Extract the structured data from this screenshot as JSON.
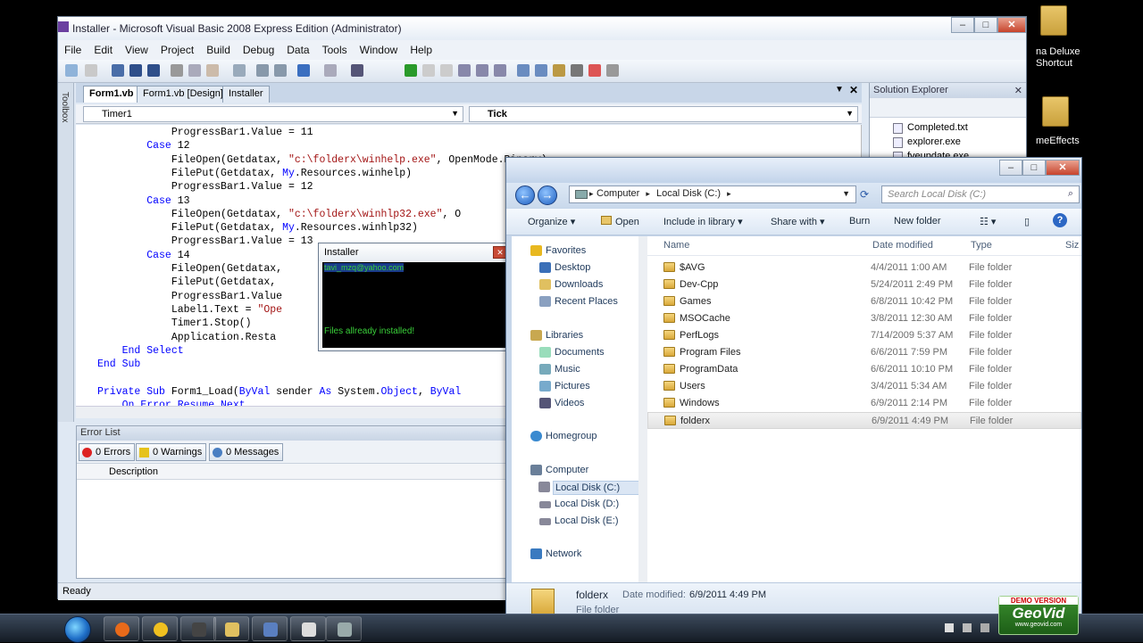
{
  "vs": {
    "title": "Installer - Microsoft Visual Basic 2008 Express Edition (Administrator)",
    "menu": [
      "File",
      "Edit",
      "View",
      "Project",
      "Build",
      "Debug",
      "Data",
      "Tools",
      "Window",
      "Help"
    ],
    "toolbox_label": "Toolbox",
    "tabs": [
      "Form1.vb",
      "Form1.vb [Design]",
      "Installer"
    ],
    "combo_left": "Timer1",
    "combo_right": "Tick",
    "code_lines": [
      {
        "indent": "            ",
        "parts": [
          [
            "",
            "ProgressBar1.Value = 11"
          ]
        ]
      },
      {
        "indent": "        ",
        "parts": [
          [
            "kw",
            "Case"
          ],
          [
            "",
            " 12"
          ]
        ]
      },
      {
        "indent": "            ",
        "parts": [
          [
            "",
            "FileOpen(Getdatax, "
          ],
          [
            "str",
            "\"c:\\folderx\\winhelp.exe\""
          ],
          [
            "",
            ", OpenMode.Binary)"
          ]
        ]
      },
      {
        "indent": "            ",
        "parts": [
          [
            "",
            "FilePut(Getdatax, "
          ],
          [
            "kw",
            "My"
          ],
          [
            "",
            ".Resources.winhelp)"
          ]
        ]
      },
      {
        "indent": "            ",
        "parts": [
          [
            "",
            "ProgressBar1.Value = 12"
          ]
        ]
      },
      {
        "indent": "        ",
        "parts": [
          [
            "kw",
            "Case"
          ],
          [
            "",
            " 13"
          ]
        ]
      },
      {
        "indent": "            ",
        "parts": [
          [
            "",
            "FileOpen(Getdatax, "
          ],
          [
            "str",
            "\"c:\\folderx\\winhlp32.exe\""
          ],
          [
            "",
            ", O"
          ]
        ]
      },
      {
        "indent": "            ",
        "parts": [
          [
            "",
            "FilePut(Getdatax, "
          ],
          [
            "kw",
            "My"
          ],
          [
            "",
            ".Resources.winhlp32)"
          ]
        ]
      },
      {
        "indent": "            ",
        "parts": [
          [
            "",
            "ProgressBar1.Value = 13"
          ]
        ]
      },
      {
        "indent": "        ",
        "parts": [
          [
            "kw",
            "Case"
          ],
          [
            "",
            " 14"
          ]
        ]
      },
      {
        "indent": "            ",
        "parts": [
          [
            "",
            "FileOpen(Getdatax,"
          ]
        ]
      },
      {
        "indent": "            ",
        "parts": [
          [
            "",
            "FilePut(Getdatax,"
          ]
        ]
      },
      {
        "indent": "            ",
        "parts": [
          [
            "",
            "ProgressBar1.Value"
          ]
        ]
      },
      {
        "indent": "            ",
        "parts": [
          [
            "",
            "Label1.Text = "
          ],
          [
            "str",
            "\"Ope"
          ]
        ]
      },
      {
        "indent": "            ",
        "parts": [
          [
            "",
            "Timer1.Stop()"
          ]
        ]
      },
      {
        "indent": "            ",
        "parts": [
          [
            "",
            "Application.Resta"
          ]
        ]
      },
      {
        "indent": "    ",
        "parts": [
          [
            "kw",
            "End Select"
          ]
        ]
      },
      {
        "indent": "",
        "parts": [
          [
            "kw",
            "End Sub"
          ]
        ]
      },
      {
        "indent": "",
        "parts": [
          [
            "",
            ""
          ]
        ]
      },
      {
        "indent": "",
        "parts": [
          [
            "kw",
            "Private Sub"
          ],
          [
            "",
            " Form1_Load("
          ],
          [
            "kw",
            "ByVal"
          ],
          [
            "",
            " sender "
          ],
          [
            "kw",
            "As"
          ],
          [
            "",
            " System."
          ],
          [
            "kw",
            "Object"
          ],
          [
            "",
            ", "
          ],
          [
            "kw",
            "ByVal"
          ]
        ]
      },
      {
        "indent": "    ",
        "parts": [
          [
            "kw",
            "On Error Resume Next"
          ]
        ]
      }
    ],
    "error_list": {
      "title": "Error List",
      "errors": "0 Errors",
      "warnings": "0 Warnings",
      "messages": "0 Messages",
      "col_description": "Description"
    },
    "status": "Ready"
  },
  "solution_explorer": {
    "title": "Solution Explorer",
    "items": [
      "Completed.txt",
      "explorer.exe",
      "fveupdate.exe"
    ]
  },
  "desktop": {
    "icon1": "na Deluxe\nShortcut",
    "icon2": "meEffects"
  },
  "installer_popup": {
    "title": "Installer",
    "email": "tavi_mzq@yahoo.com",
    "message": "Files allready installed!"
  },
  "explorer": {
    "path": [
      "Computer",
      "Local Disk (C:)"
    ],
    "search_placeholder": "Search Local Disk (C:)",
    "commands": [
      "Organize",
      "Open",
      "Include in library",
      "Share with",
      "Burn",
      "New folder"
    ],
    "nav": {
      "favorites": "Favorites",
      "fav_items": [
        "Desktop",
        "Downloads",
        "Recent Places"
      ],
      "libraries": "Libraries",
      "lib_items": [
        "Documents",
        "Music",
        "Pictures",
        "Videos"
      ],
      "homegroup": "Homegroup",
      "computer": "Computer",
      "comp_items": [
        "Local Disk (C:)",
        "Local Disk (D:)",
        "Local Disk (E:)"
      ],
      "network": "Network"
    },
    "columns": [
      "Name",
      "Date modified",
      "Type",
      "Siz"
    ],
    "files": [
      {
        "name": "$AVG",
        "date": "4/4/2011 1:00 AM",
        "type": "File folder"
      },
      {
        "name": "Dev-Cpp",
        "date": "5/24/2011 2:49 PM",
        "type": "File folder"
      },
      {
        "name": "Games",
        "date": "6/8/2011 10:42 PM",
        "type": "File folder"
      },
      {
        "name": "MSOCache",
        "date": "3/8/2011 12:30 AM",
        "type": "File folder"
      },
      {
        "name": "PerfLogs",
        "date": "7/14/2009 5:37 AM",
        "type": "File folder"
      },
      {
        "name": "Program Files",
        "date": "6/6/2011 7:59 PM",
        "type": "File folder"
      },
      {
        "name": "ProgramData",
        "date": "6/6/2011 10:10 PM",
        "type": "File folder"
      },
      {
        "name": "Users",
        "date": "3/4/2011 5:34 AM",
        "type": "File folder"
      },
      {
        "name": "Windows",
        "date": "6/9/2011 2:14 PM",
        "type": "File folder"
      },
      {
        "name": "folderx",
        "date": "6/9/2011 4:49 PM",
        "type": "File folder"
      }
    ],
    "details": {
      "name": "folderx",
      "date_label": "Date modified:",
      "date_value": "6/9/2011 4:49 PM",
      "type": "File folder"
    }
  },
  "watermark": {
    "line1": "DEMO VERSION",
    "line2": "GeoVid",
    "line3": "www.geovid.com"
  }
}
